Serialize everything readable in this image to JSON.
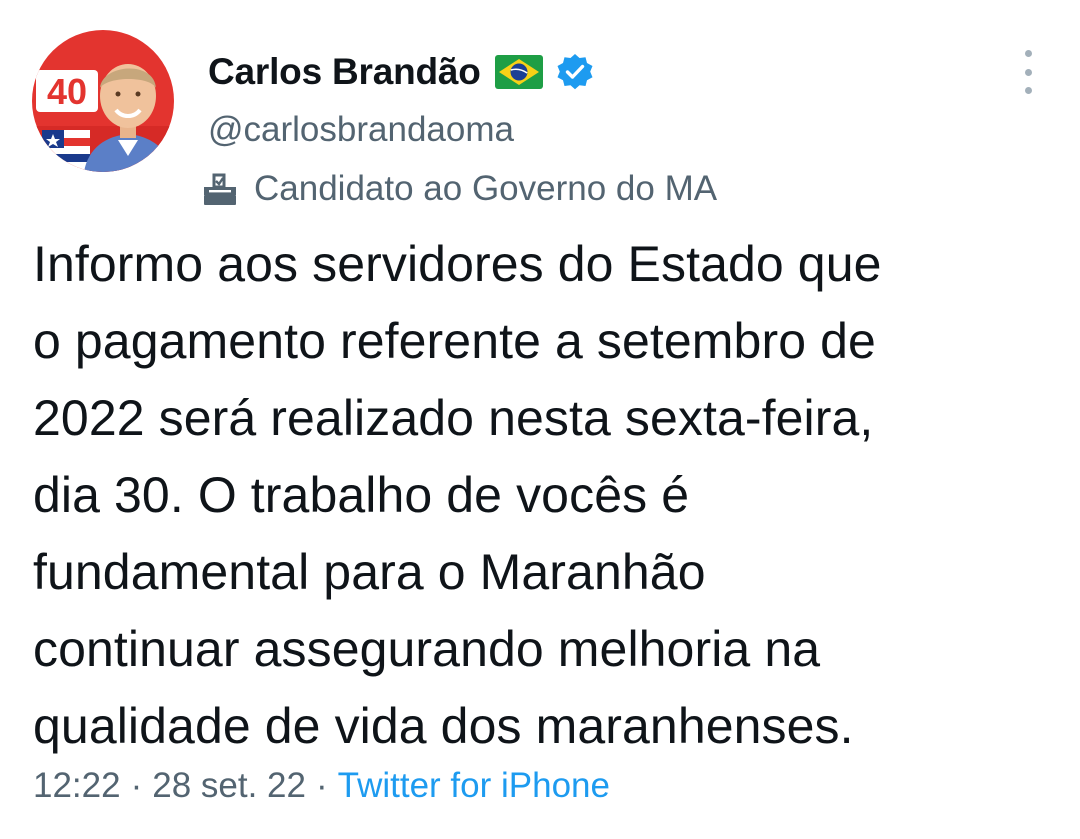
{
  "author": {
    "display_name": "Carlos Brandão",
    "flag_emoji": "brazil-flag",
    "verified": true,
    "handle": "@carlosbrandaoma",
    "avatar_badge": "40",
    "label": "Candidato ao Governo do MA",
    "label_icon": "ballot-box-icon"
  },
  "tweet": {
    "lines": [
      "Informo aos servidores do Estado que",
      "o pagamento referente a setembro de",
      "2022 será realizado nesta sexta-feira,",
      "dia 30. O trabalho de vocês é",
      "fundamental para o Maranhão",
      "continuar assegurando melhoria na",
      "qualidade de vida dos maranhenses."
    ]
  },
  "meta": {
    "time": "12:22",
    "separator": "·",
    "date": "28 set. 22",
    "source": "Twitter for iPhone"
  },
  "colors": {
    "text_primary": "#0f1419",
    "text_secondary": "#536471",
    "link": "#1d9bf0",
    "verified": "#1d9bf0",
    "avatar_red": "#e3342f"
  }
}
